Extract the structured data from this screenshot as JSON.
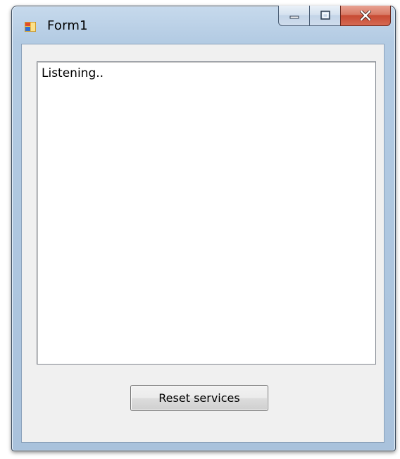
{
  "window": {
    "title": "Form1",
    "icon": "winforms-app-icon"
  },
  "caption_buttons": {
    "minimize": "minimize-icon",
    "maximize": "maximize-icon",
    "close": "close-icon"
  },
  "log": {
    "text": "Listening.."
  },
  "actions": {
    "reset_label": "Reset services"
  },
  "colors": {
    "frame": "#b3cbe3",
    "client": "#f0f0f0",
    "close_button": "#c74a33"
  }
}
